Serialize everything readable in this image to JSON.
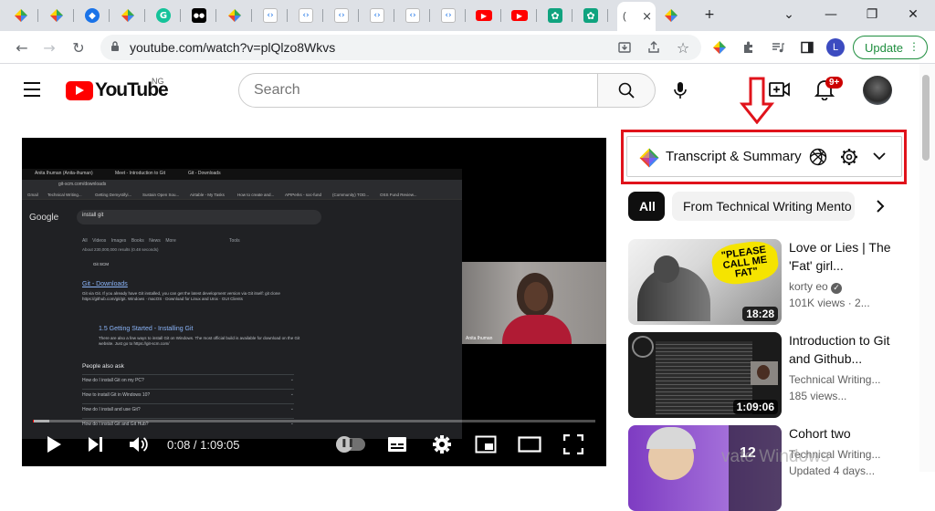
{
  "browser": {
    "tabs": [
      {
        "icon": "diamond-ext-icon",
        "color": "#ffffff"
      },
      {
        "icon": "diamond-ext-icon",
        "color": "#ffffff"
      },
      {
        "icon": "blue-diamond-icon",
        "color": "#1a73e8"
      },
      {
        "icon": "diamond-ext-icon",
        "color": "#ffffff"
      },
      {
        "icon": "grammarly-icon",
        "color": "#15c39a"
      },
      {
        "icon": "medium-icon",
        "color": "#000000"
      },
      {
        "icon": "diamond-ext-icon",
        "color": "#ffffff"
      },
      {
        "icon": "code-icon",
        "color": "#ffffff"
      },
      {
        "icon": "code-icon",
        "color": "#ffffff"
      },
      {
        "icon": "code-icon",
        "color": "#ffffff"
      },
      {
        "icon": "code-icon",
        "color": "#ffffff"
      },
      {
        "icon": "code-icon",
        "color": "#ffffff"
      },
      {
        "icon": "code-icon",
        "color": "#ffffff"
      },
      {
        "icon": "youtube-icon",
        "color": "#ff0000"
      },
      {
        "icon": "youtube-icon",
        "color": "#ff0000"
      },
      {
        "icon": "chatgpt-icon",
        "color": "#10a37f"
      },
      {
        "icon": "chatgpt-icon",
        "color": "#10a37f"
      }
    ],
    "active_tab_label": "(",
    "close_glyph": "×",
    "new_tab_glyph": "+",
    "url": "youtube.com/watch?v=plQlzo8Wkvs",
    "profile_letter": "L",
    "update_label": "Update"
  },
  "youtube": {
    "logo_text": "YouTube",
    "country_code": "NG",
    "search_placeholder": "Search",
    "notification_count": "9+"
  },
  "extension": {
    "title": "Transcript & Summary"
  },
  "chips": {
    "all": "All",
    "tech": "From Technical Writing Mento"
  },
  "player": {
    "time": "0:08 / 1:09:05",
    "progress": 0.002,
    "buffer": 0.03,
    "inner": {
      "tabs": [
        "Anita Ihuman (Anita-ihuman)",
        "Meet - Introduction to Git",
        "Git - Downloads"
      ],
      "url": "git-scm.com/downloads",
      "bookmarks": [
        "Gmail",
        "Technical Writing...",
        "Getting Demystifyi...",
        "Sustain Open Sou...",
        "Airtable - My Tasks",
        "How to create and...",
        "APIPerks - soc-fund",
        "(Community) TOD...",
        "OSS Fund Review..."
      ],
      "google": "Google",
      "query": "install git",
      "search_tabs": "All    Videos    Images    Books    News    More                                          Tools",
      "results_count": "About 230,000,000 results (0.48 seconds)",
      "site_name": "Git SCM",
      "result1_title": "Git - Downloads",
      "result1_snippet": "Git via Git. If you already have Git installed, you can get the latest development version via Git itself: git clone https://github.com/git/git. Windows · macOS · Download for Linux and Unix · GUI Clients",
      "result2_title": "1.5 Getting Started - Installing Git",
      "result2_snippet": "There are also a few ways to install Git on Windows. The most official build is available for download on the Git website. Just go to https://git-scm.com/",
      "people_also_ask": "People also ask",
      "questions": [
        "How do I install Git on my PC?",
        "How to install Git in Windows 10?",
        "How do I install and use Git?",
        "How do I install Git and Git Hub?"
      ],
      "cam_name": "Anita Ihuman"
    }
  },
  "videos": [
    {
      "title": "Love or Lies | The 'Fat' girl...",
      "channel": "korty eo",
      "verified": true,
      "views": "101K views · 2...",
      "duration": "18:28",
      "thumb_badge": "\"PLEASE CALL ME FAT\""
    },
    {
      "title": "Introduction to Git and Github...",
      "channel": "Technical Writing...",
      "verified": false,
      "views": "185 views...",
      "duration": "1:09:06",
      "thumb_badge": ""
    },
    {
      "title": "Cohort two",
      "channel": "Technical Writing...",
      "verified": false,
      "views": "Updated 4 days...",
      "duration": "12",
      "thumb_badge": ""
    }
  ],
  "watermark": "vate Windows"
}
